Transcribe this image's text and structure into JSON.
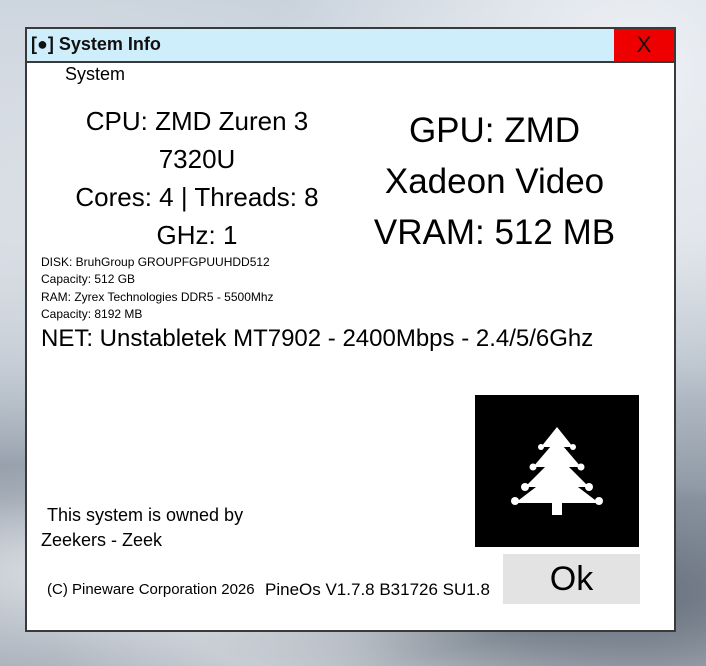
{
  "window": {
    "title": "[●] System Info",
    "close_label": "X",
    "section_label": "System"
  },
  "cpu": {
    "line1": "CPU: ZMD Zuren 3",
    "line2": "7320U",
    "line3": "Cores: 4 | Threads: 8",
    "line4": "GHz: 1"
  },
  "gpu": {
    "line1": "GPU: ZMD",
    "line2": "Xadeon Video",
    "line3": "VRAM: 512 MB"
  },
  "disk": {
    "name": "DISK: BruhGroup GROUPFGPUUHDD512",
    "capacity": "Capacity: 512 GB"
  },
  "ram": {
    "name": "RAM: Zyrex Technologies DDR5 - 5500Mhz",
    "capacity": "Capacity: 8192 MB"
  },
  "net": "NET: Unstabletek MT7902 - 2400Mbps - 2.4/5/6Ghz",
  "owner": {
    "line1": "This system is owned by",
    "line2": "Zeekers - Zeek"
  },
  "footer": {
    "copyright": "(C) Pineware Corporation 2026",
    "version": "PineOs V1.7.8 B31726 SU1.8"
  },
  "ok_label": "Ok",
  "logo": {
    "icon": "pine-tree-icon",
    "color": "#ffffff",
    "background": "#000000"
  },
  "colors": {
    "titlebar": "#cfeefb",
    "close": "#ee0000",
    "ok_button": "#e3e3e3"
  }
}
